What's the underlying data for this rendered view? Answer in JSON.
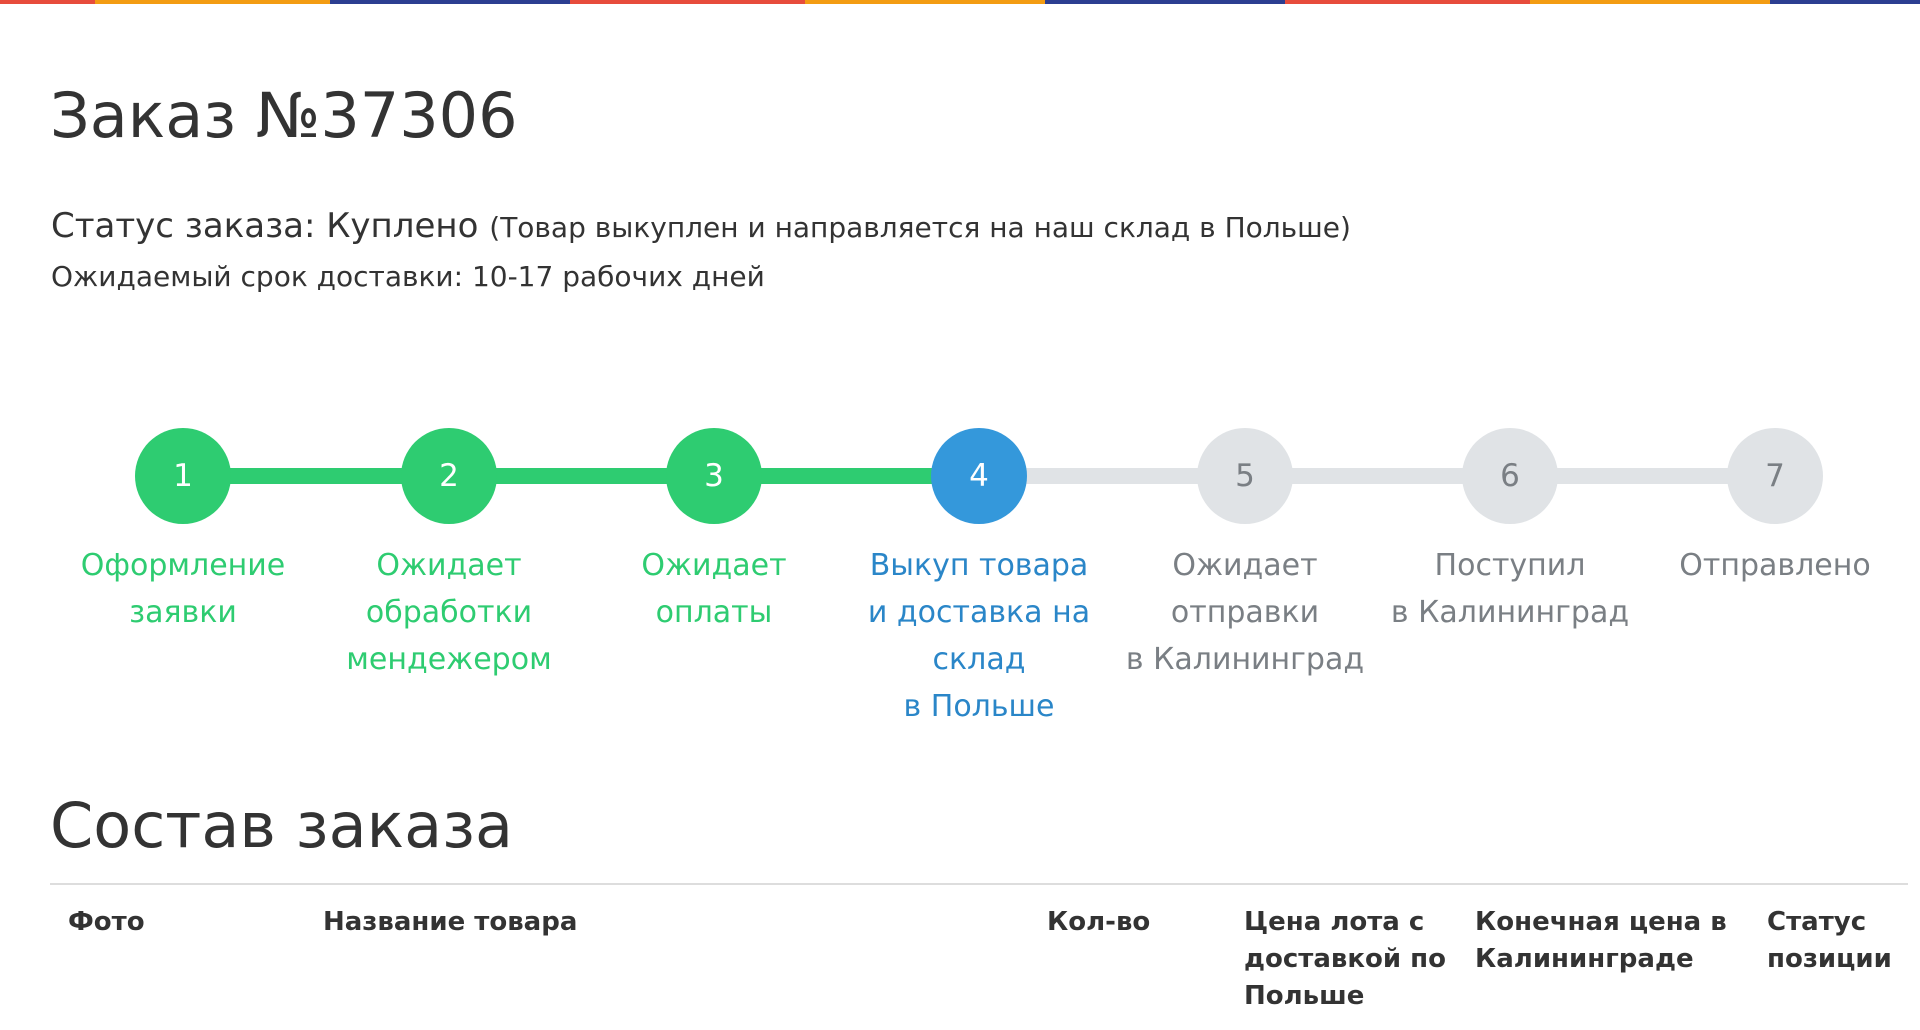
{
  "colors": {
    "done": "#2ecc71",
    "active": "#3498db",
    "pending": "#e0e3e6",
    "stripe": [
      "#e74c3c",
      "#f39c12",
      "#2c3e91",
      "#e74c3c",
      "#f39c12",
      "#2c3e91",
      "#e74c3c",
      "#f39c12",
      "#2c3e91"
    ]
  },
  "order": {
    "title": "Заказ №37306",
    "status_label": "Статус заказа: Куплено",
    "status_description": "(Товар выкуплен и направляется на наш склад в Польше)",
    "delivery_estimate": "Ожидаемый срок доставки: 10-17 рабочих дней"
  },
  "progress": {
    "current_step": 4,
    "steps": [
      {
        "number": "1",
        "label": "Оформление\nзаявки",
        "state": "done"
      },
      {
        "number": "2",
        "label": "Ожидает\nобработки\nмендежером",
        "state": "done"
      },
      {
        "number": "3",
        "label": "Ожидает\nоплаты",
        "state": "done"
      },
      {
        "number": "4",
        "label": "Выкуп товара\nи доставка на\nсклад\nв Польше",
        "state": "active"
      },
      {
        "number": "5",
        "label": "Ожидает\nотправки\nв Калининград",
        "state": "todo"
      },
      {
        "number": "6",
        "label": "Поступил\nв Калининград",
        "state": "todo"
      },
      {
        "number": "7",
        "label": "Отправлено",
        "state": "todo"
      }
    ]
  },
  "composition": {
    "title": "Состав заказа",
    "columns": [
      "Фото",
      "Название товара",
      "Кол-во",
      "Цена лота с\nдоставкой по\nПольше",
      "Конечная цена в\nКалининграде",
      "Статус\nпозиции"
    ]
  }
}
